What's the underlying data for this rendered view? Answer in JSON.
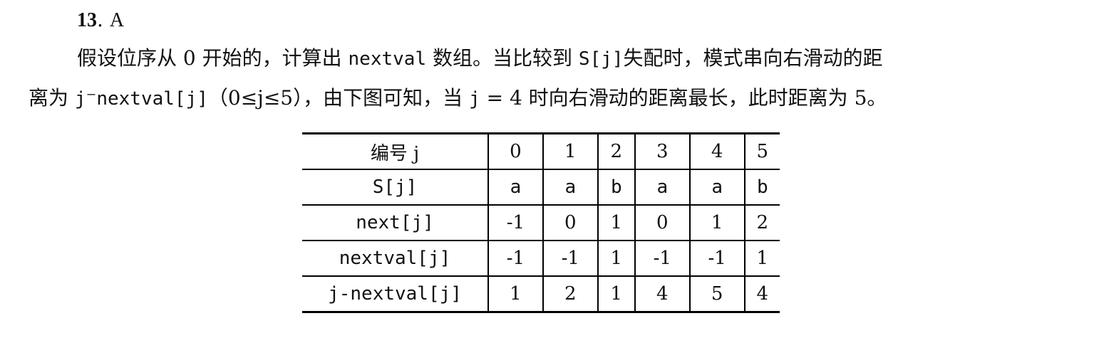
{
  "heading": {
    "number": "13",
    "separator": ".",
    "answer": "A"
  },
  "paragraph": {
    "line1_a": "假设位序从 0 开始的，计算出 ",
    "line1_code1": "nextval",
    "line1_b": " 数组。当比较到 ",
    "line1_code2": "S[j]",
    "line1_c": "失配时，模式串向右滑动的距",
    "line2_a": "离为 ",
    "line2_code1": "j",
    "line2_dash": "⁻",
    "line2_code2": "nextval[j]",
    "line2_b": "（0≤j≤5），由下图可知，当 ",
    "line2_code3": "j",
    "line2_c": " = 4 时向右滑动的距离最长，此时距离为 5。"
  },
  "table": {
    "rows": [
      {
        "label": "编号 j",
        "cells": [
          "0",
          "1",
          "2",
          "3",
          "4",
          "5"
        ]
      },
      {
        "label": "S[j]",
        "cells": [
          "a",
          "a",
          "b",
          "a",
          "a",
          "b"
        ]
      },
      {
        "label": "next[j]",
        "cells": [
          "-1",
          "0",
          "1",
          "0",
          "1",
          "2"
        ]
      },
      {
        "label": "nextval[j]",
        "cells": [
          "-1",
          "-1",
          "1",
          "-1",
          "-1",
          "1"
        ]
      },
      {
        "label": "j-nextval[j]",
        "cells": [
          "1",
          "2",
          "1",
          "4",
          "5",
          "4"
        ]
      }
    ]
  }
}
